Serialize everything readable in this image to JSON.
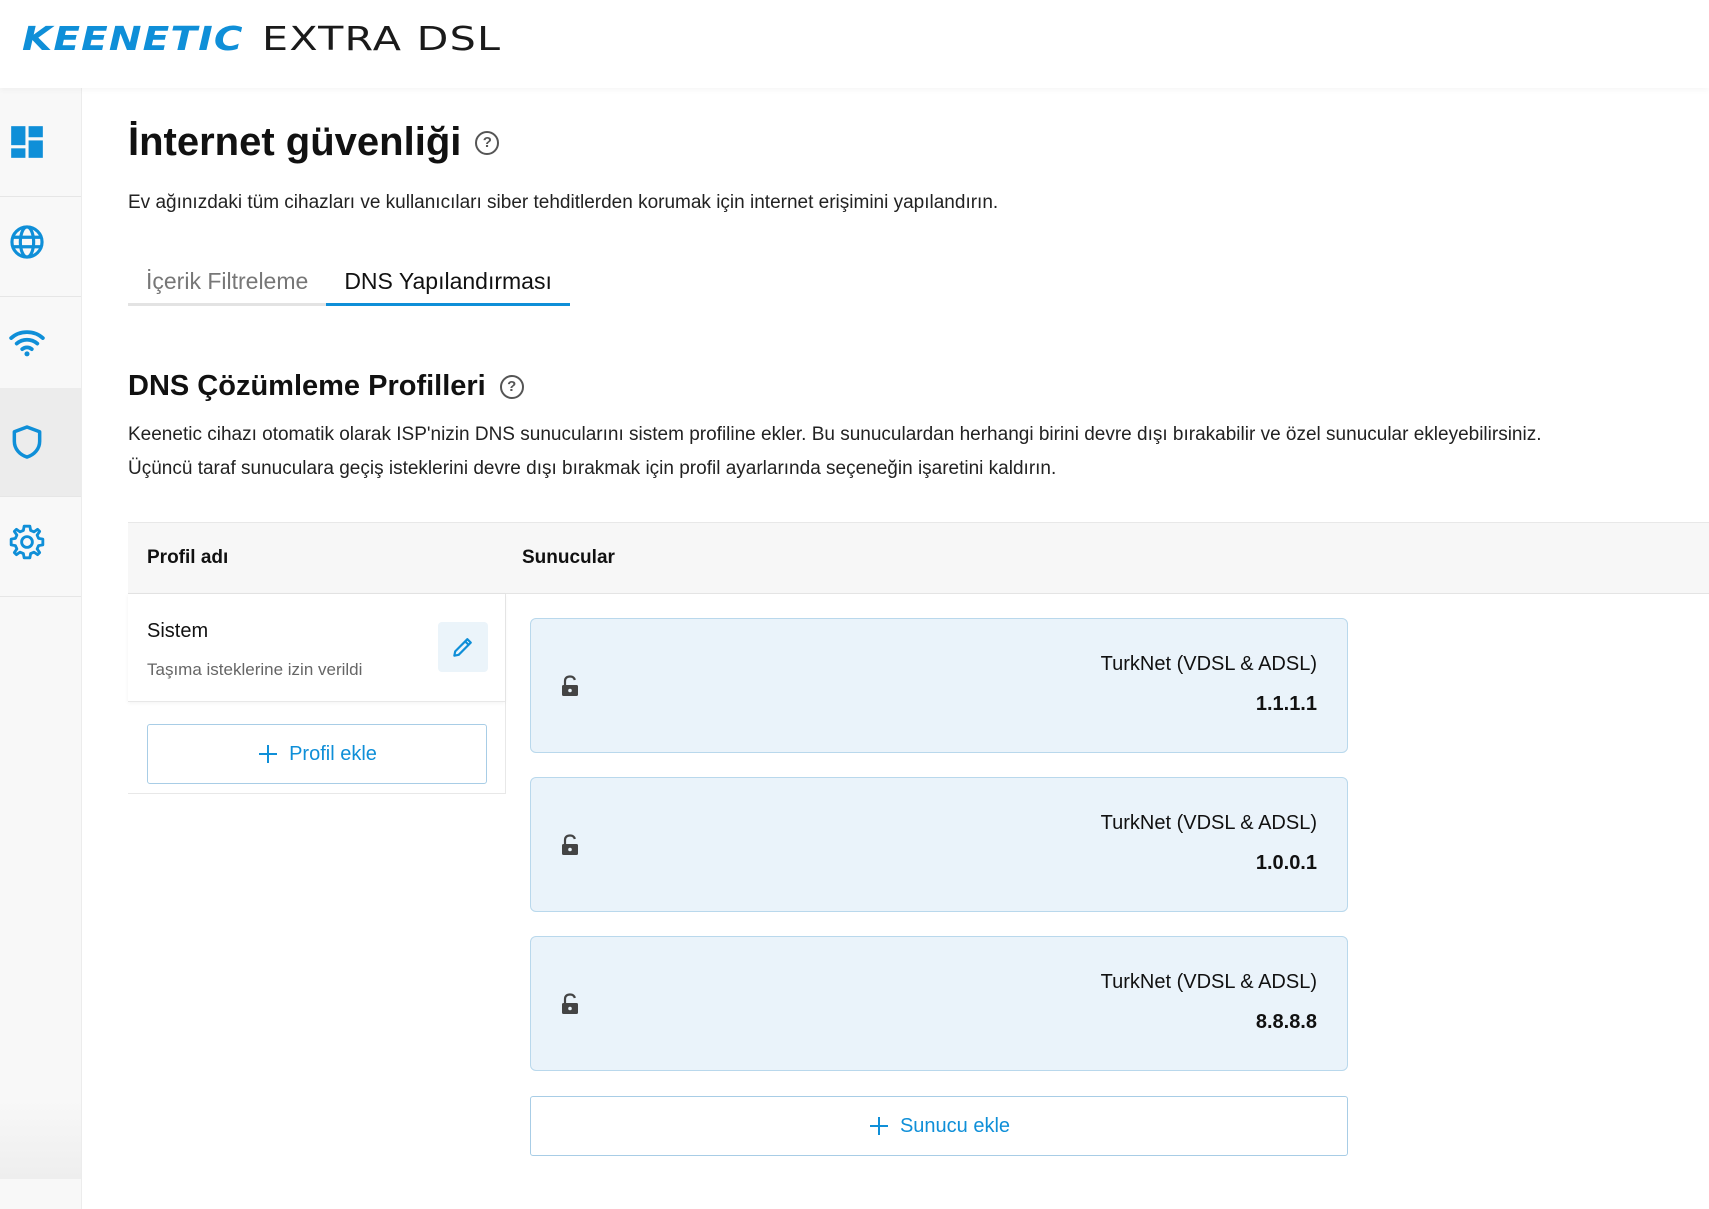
{
  "header": {
    "brand": "KEENETIC",
    "model": "EXTRA DSL"
  },
  "sidebar": {
    "items": [
      {
        "name": "dashboard",
        "icon": "dashboard-icon",
        "active": false
      },
      {
        "name": "internet",
        "icon": "globe-icon",
        "active": false
      },
      {
        "name": "wifi",
        "icon": "wifi-icon",
        "active": false
      },
      {
        "name": "security",
        "icon": "shield-icon",
        "active": true
      },
      {
        "name": "settings",
        "icon": "gear-icon",
        "active": false
      }
    ],
    "accent": "#0f8fd8"
  },
  "page": {
    "title": "İnternet güvenliği",
    "description": "Ev ağınızdaki tüm cihazları ve kullanıcıları siber tehditlerden korumak için internet erişimini yapılandırın."
  },
  "tabs": [
    {
      "label": "İçerik Filtreleme",
      "active": false
    },
    {
      "label": "DNS Yapılandırması",
      "active": true
    }
  ],
  "section": {
    "title": "DNS Çözümleme Profilleri",
    "description_line1": "Keenetic cihazı otomatik olarak ISP'nizin DNS sunucularını sistem profiline ekler. Bu sunuculardan herhangi birini devre dışı bırakabilir ve özel sunucular ekleyebilirsiniz.",
    "description_line2": "Üçüncü taraf sunuculara geçiş isteklerini devre dışı bırakmak için profil ayarlarında seçeneğin işaretini kaldırın."
  },
  "table": {
    "col_profile": "Profil adı",
    "col_servers": "Sunucular"
  },
  "profile": {
    "name": "Sistem",
    "status": "Taşıma isteklerine izin verildi",
    "edit_icon": "pencil-icon",
    "add_label": "Profil ekle"
  },
  "servers": [
    {
      "provider": "TurkNet (VDSL & ADSL)",
      "ip": "1.1.1.1",
      "icon": "lock-icon"
    },
    {
      "provider": "TurkNet (VDSL & ADSL)",
      "ip": "1.0.0.1",
      "icon": "lock-icon"
    },
    {
      "provider": "TurkNet (VDSL & ADSL)",
      "ip": "8.8.8.8",
      "icon": "lock-icon"
    }
  ],
  "add_server_label": "Sunucu ekle"
}
